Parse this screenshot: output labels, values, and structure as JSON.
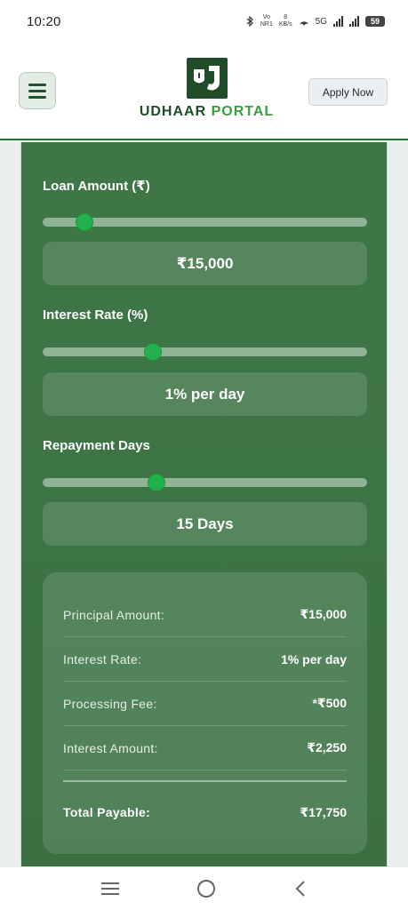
{
  "status_bar": {
    "time": "10:20",
    "network_top": "Vo",
    "network_bottom": "NR1",
    "speed_top": "8",
    "speed_bottom": "KB/s",
    "network_type": "5G",
    "battery": "59"
  },
  "header": {
    "logo_word1": "UDHAAR",
    "logo_word2": "PORTAL",
    "apply_label": "Apply Now",
    "colors": {
      "brand_dark": "#1f4d2a",
      "brand_light": "#3f9b3f"
    }
  },
  "calculator": {
    "loan": {
      "label": "Loan Amount (₹)",
      "display": "₹15,000",
      "slider_fraction": 0.13
    },
    "interest": {
      "label": "Interest Rate (%)",
      "display": "1% per day",
      "slider_fraction": 0.34
    },
    "days": {
      "label": "Repayment Days",
      "display": "15 Days",
      "slider_fraction": 0.35
    },
    "colors": {
      "panel": "#3d7445",
      "thumb": "#22b14c",
      "track": "#8fb394"
    }
  },
  "summary": {
    "rows": [
      {
        "label": "Principal Amount:",
        "value": "₹15,000"
      },
      {
        "label": "Interest Rate:",
        "value": "1% per day"
      },
      {
        "label": "Processing Fee:",
        "value": "*₹500"
      },
      {
        "label": "Interest Amount:",
        "value": "₹2,250"
      }
    ],
    "total": {
      "label": "Total Payable:",
      "value": "₹17,750"
    }
  },
  "nav": {
    "icons": [
      "recent-apps-icon",
      "home-icon",
      "back-icon"
    ]
  }
}
